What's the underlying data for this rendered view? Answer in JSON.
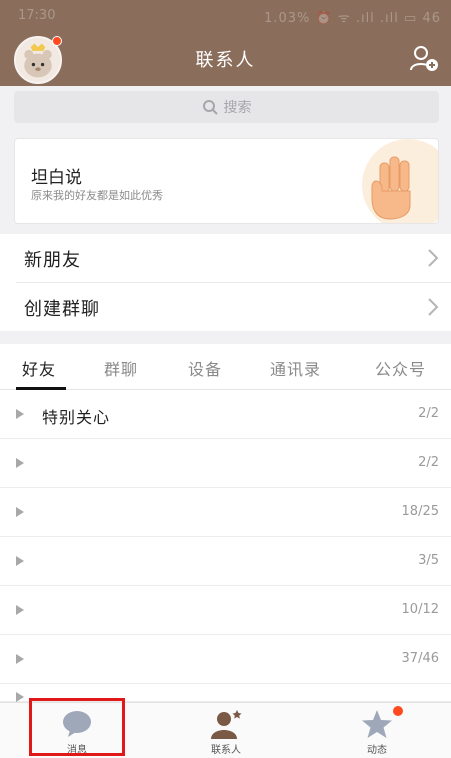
{
  "status": {
    "time": "17:30",
    "right": "1.03% ⏰ ᯤ .ıll .ıll ▭ 46"
  },
  "header": {
    "title": "联系人"
  },
  "search": {
    "placeholder": "搜索"
  },
  "confess": {
    "title": "坦白说",
    "subtitle": "原来我的好友都是如此优秀"
  },
  "rows": {
    "new_friends": "新朋友",
    "create_group": "创建群聊"
  },
  "tabs": [
    "好友",
    "群聊",
    "设备",
    "通讯录",
    "公众号"
  ],
  "active_tab": "好友",
  "groups": [
    {
      "name": "特别关心",
      "count": "2/2"
    },
    {
      "name": "",
      "count": "2/2"
    },
    {
      "name": "",
      "count": "18/25"
    },
    {
      "name": "",
      "count": "3/5"
    },
    {
      "name": "",
      "count": "10/12"
    },
    {
      "name": "",
      "count": "37/46"
    }
  ],
  "bottom_nav": {
    "messages": "消息",
    "contacts": "联系人",
    "moments": "动态"
  },
  "colors": {
    "header": "#8a6e5b",
    "badge": "#ff4a20",
    "highlight": "#e01818"
  }
}
